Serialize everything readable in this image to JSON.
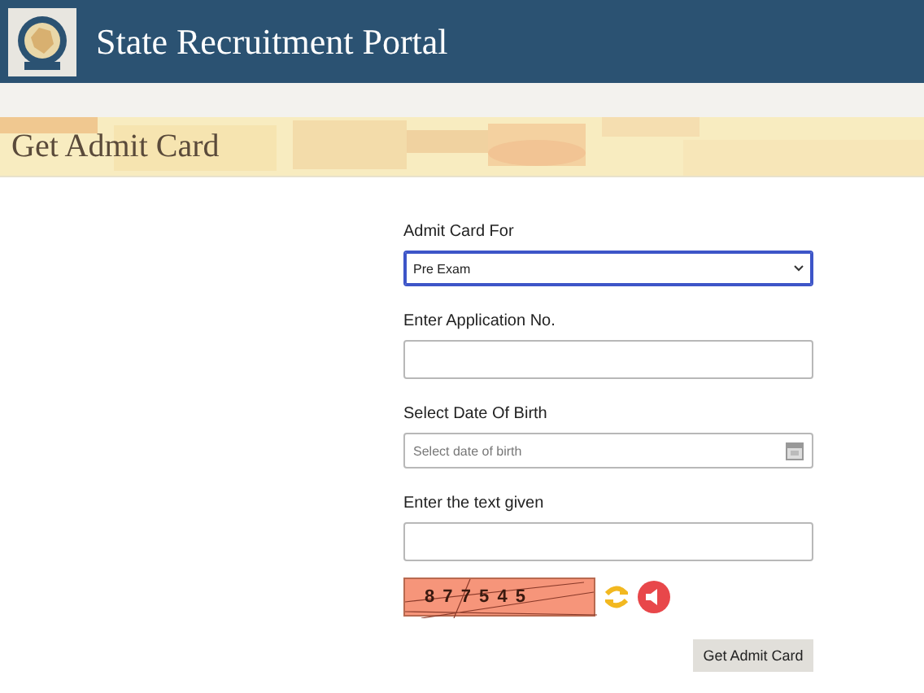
{
  "header": {
    "title": "State Recruitment Portal"
  },
  "banner": {
    "title": "Get Admit Card"
  },
  "form": {
    "fields": [
      {
        "kind": "select",
        "label": "Admit Card For",
        "value": "Pre Exam"
      },
      {
        "kind": "text",
        "label": "Enter Application No."
      },
      {
        "kind": "date",
        "label": "Select Date Of Birth",
        "placeholder": "Select date of birth"
      },
      {
        "kind": "text",
        "label": "Enter the text given"
      }
    ],
    "captcha": "8 7 7 5 4 5",
    "submit": "Get Admit Card"
  }
}
